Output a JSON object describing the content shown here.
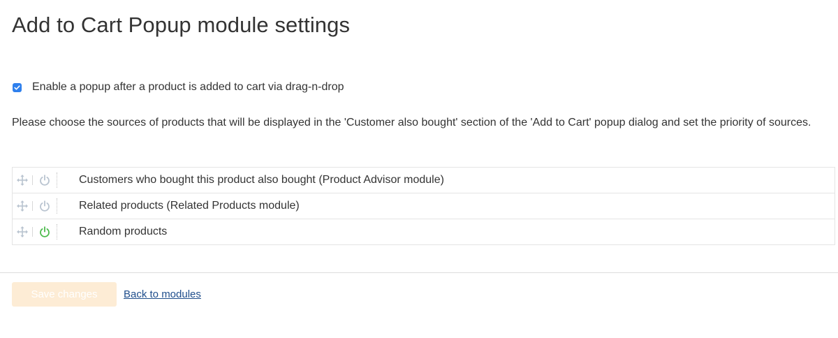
{
  "page": {
    "title": "Add to Cart Popup module settings"
  },
  "settings": {
    "enable_label": "Enable a popup after a product is added to cart via drag-n-drop",
    "enable_checked": true,
    "description": "Please choose the sources of products that will be displayed in the 'Customer also bought' section of the 'Add to Cart' popup dialog and set the priority of sources."
  },
  "sources": [
    {
      "label": "Customers who bought this product also bought (Product Advisor module)",
      "enabled": false
    },
    {
      "label": "Related products (Related Products module)",
      "enabled": false
    },
    {
      "label": "Random products",
      "enabled": true
    }
  ],
  "actions": {
    "save_label": "Save changes",
    "back_label": "Back to modules"
  },
  "colors": {
    "power_on": "#4cba4c",
    "power_off": "#b9c4d0",
    "checkbox": "#2f80ed",
    "save_disabled": "#fdecd5"
  },
  "icons": {
    "drag": "move-arrows-icon",
    "power": "power-icon",
    "check": "checkmark-icon"
  }
}
